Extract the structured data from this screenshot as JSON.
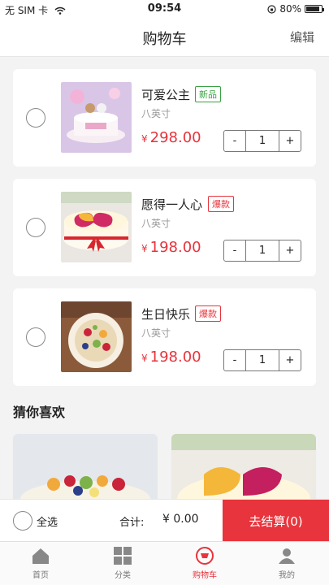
{
  "status_bar": {
    "carrier": "无 SIM 卡",
    "time": "09:54",
    "battery": "80%"
  },
  "nav": {
    "title": "购物车",
    "edit_label": "编辑"
  },
  "cart_items": [
    {
      "name": "可爱公主",
      "badge": "新品",
      "badge_color": "#3aa143",
      "spec": "八英寸",
      "currency": "¥",
      "price": "298.00",
      "quantity": "1",
      "minus": "-",
      "plus": "+"
    },
    {
      "name": "愿得一人心",
      "badge": "爆款",
      "badge_color": "#e8343c",
      "spec": "八英寸",
      "currency": "¥",
      "price": "198.00",
      "quantity": "1",
      "minus": "-",
      "plus": "+"
    },
    {
      "name": "生日快乐",
      "badge": "爆款",
      "badge_color": "#e8343c",
      "spec": "八英寸",
      "currency": "¥",
      "price": "198.00",
      "quantity": "1",
      "minus": "-",
      "plus": "+"
    }
  ],
  "recommend": {
    "title": "猜你喜欢"
  },
  "checkout": {
    "select_all": "全选",
    "total_label": "合计:",
    "total_value": "¥ 0.00",
    "pay_button": "去结算(0)"
  },
  "tabs": [
    {
      "label": "首页",
      "icon": "home-icon"
    },
    {
      "label": "分类",
      "icon": "grid-icon"
    },
    {
      "label": "购物车",
      "icon": "cart-icon",
      "active": true
    },
    {
      "label": "我的",
      "icon": "user-icon"
    }
  ],
  "colors": {
    "accent": "#e8343c",
    "new_badge": "#3aa143",
    "background": "#f3f3f3"
  }
}
